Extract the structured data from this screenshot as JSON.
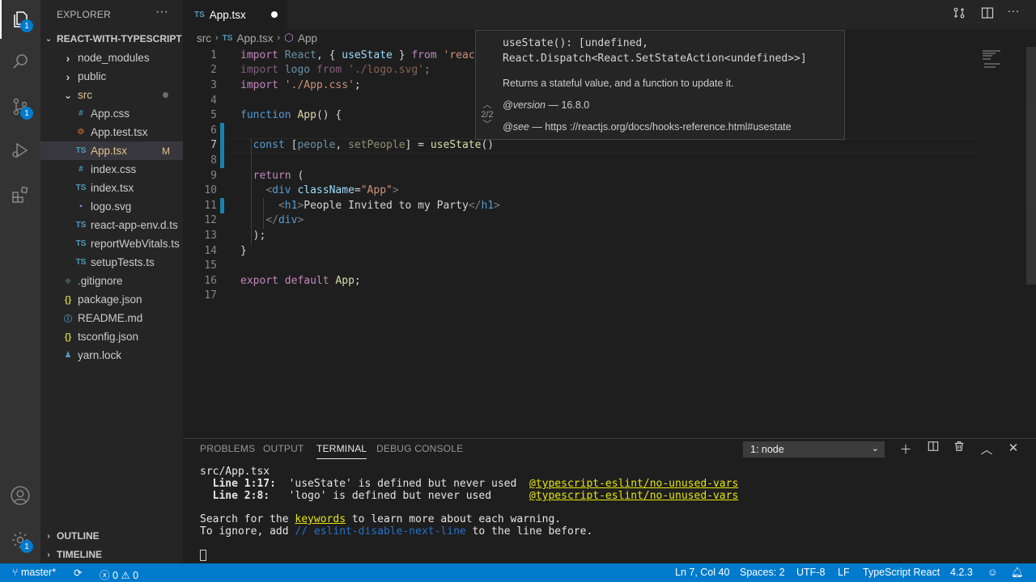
{
  "activity_bar": {
    "explorer_badge": "1",
    "scm_badge": "1",
    "settings_badge": "1"
  },
  "explorer": {
    "title": "EXPLORER",
    "more": "···",
    "project": "REACT-WITH-TYPESCRIPT",
    "items": [
      {
        "label": "node_modules",
        "kind": "folder-closed",
        "color": "#cccccc"
      },
      {
        "label": "public",
        "kind": "folder-closed",
        "color": "#cccccc"
      },
      {
        "label": "src",
        "kind": "folder-open",
        "color": "#e2c08d"
      },
      {
        "label": "App.css",
        "icon": "#",
        "color": "#cccccc"
      },
      {
        "label": "App.test.tsx",
        "icon": "⚙",
        "color": "#cccccc"
      },
      {
        "label": "App.tsx",
        "icon": "TS",
        "color": "#e2c08d",
        "status": "M"
      },
      {
        "label": "index.css",
        "icon": "#",
        "color": "#cccccc"
      },
      {
        "label": "index.tsx",
        "icon": "TS",
        "color": "#cccccc"
      },
      {
        "label": "logo.svg",
        "icon": "▪",
        "color": "#cccccc"
      },
      {
        "label": "react-app-env.d.ts",
        "icon": "TS",
        "color": "#cccccc"
      },
      {
        "label": "reportWebVitals.ts",
        "icon": "TS",
        "color": "#cccccc"
      },
      {
        "label": "setupTests.ts",
        "icon": "TS",
        "color": "#cccccc"
      },
      {
        "label": ".gitignore",
        "icon": "◆",
        "color": "#cccccc"
      },
      {
        "label": "package.json",
        "icon": "{}",
        "color": "#cccccc"
      },
      {
        "label": "README.md",
        "icon": "ⓘ",
        "color": "#cccccc"
      },
      {
        "label": "tsconfig.json",
        "icon": "{}",
        "color": "#cccccc"
      },
      {
        "label": "yarn.lock",
        "icon": "♟",
        "color": "#cccccc"
      }
    ],
    "outline": "OUTLINE",
    "timeline": "TIMELINE"
  },
  "tab": {
    "prefix": "TS",
    "label": "App.tsx"
  },
  "breadcrumb": {
    "folder": "src",
    "file": "App.tsx",
    "symbol": "App"
  },
  "editor": {
    "line_numbers": [
      "1",
      "2",
      "3",
      "4",
      "5",
      "6",
      "7",
      "8",
      "9",
      "10",
      "11",
      "12",
      "13",
      "14",
      "15",
      "16",
      "17"
    ]
  },
  "hover": {
    "signature_line1": "useState(): [undefined,",
    "signature_line2": "React.Dispatch<React.SetStateAction<undefined>>]",
    "description": "Returns a stateful value, and a function to update it.",
    "version_tag": "@version",
    "version_text": " — 16.8.0",
    "see_tag": "@see",
    "see_text": " — https ://reactjs.org/docs/hooks-reference.html#usestate",
    "counter": "2/2"
  },
  "panel": {
    "tabs": [
      "PROBLEMS",
      "OUTPUT",
      "TERMINAL",
      "DEBUG CONSOLE"
    ],
    "active_tab": "TERMINAL",
    "terminal_select": "1: node",
    "terminal": {
      "file": "src/App.tsx",
      "warn1_loc": "  Line 1:17:",
      "warn1_msg": "  'useState' is defined but never used  ",
      "warn1_rule": "@typescript-eslint/no-unused-vars",
      "warn2_loc": "  Line 2:8:",
      "warn2_msg": "   'logo' is defined but never used      ",
      "warn2_rule": "@typescript-eslint/no-unused-vars",
      "search_pre": "Search for the ",
      "search_kw": "keywords",
      "search_post": " to learn more about each warning.",
      "ignore_pre": "To ignore, add ",
      "ignore_kw": "// eslint-disable-next-line",
      "ignore_post": " to the line before."
    }
  },
  "status_bar": {
    "branch": "master*",
    "errors": "0",
    "warnings": "0",
    "position": "Ln 7, Col 40",
    "spaces": "Spaces: 2",
    "encoding": "UTF-8",
    "eol": "LF",
    "language": "TypeScript React",
    "version": "4.2.3"
  }
}
